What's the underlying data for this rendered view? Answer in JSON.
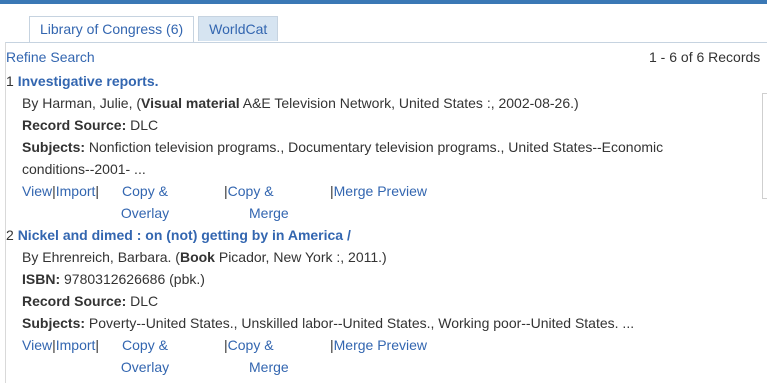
{
  "tabs": [
    {
      "label": "Library of Congress (6)"
    },
    {
      "label": "WorldCat"
    }
  ],
  "toolbar": {
    "refine_label": "Refine Search",
    "count_text": "1 - 6 of 6 Records"
  },
  "records": [
    {
      "number": "1",
      "title": "Investigative reports.",
      "by_prefix": "By Harman, Julie, (",
      "material": "Visual material",
      "by_suffix": " A&E Television Network, United States :, 2002-08-26.)",
      "source_label": "Record Source:",
      "source_value": " DLC",
      "subjects_label": "Subjects:",
      "subjects_line1": " Nonfiction television programs., Documentary television programs., United States--Economic",
      "subjects_line2": "conditions--2001- ..."
    },
    {
      "number": "2",
      "title": "Nickel and dimed : on (not) getting by in America /",
      "by_prefix": "By Ehrenreich, Barbara. (",
      "material": "Book",
      "by_suffix": " Picador, New York :, 2011.)",
      "isbn_label": "ISBN:",
      "isbn_value": " 9780312626686 (pbk.)",
      "source_label": "Record Source:",
      "source_value": " DLC",
      "subjects_label": "Subjects:",
      "subjects_line1": " Poverty--United States., Unskilled labor--United States., Working poor--United States. ..."
    }
  ],
  "actions": {
    "view": "View",
    "import": "Import",
    "sep": "|",
    "copy_overlay_1": "Copy &",
    "copy_overlay_2": "Overlay",
    "copy_merge_1": "Copy &",
    "copy_merge_2": "Merge",
    "merge_preview": "Merge Preview"
  }
}
